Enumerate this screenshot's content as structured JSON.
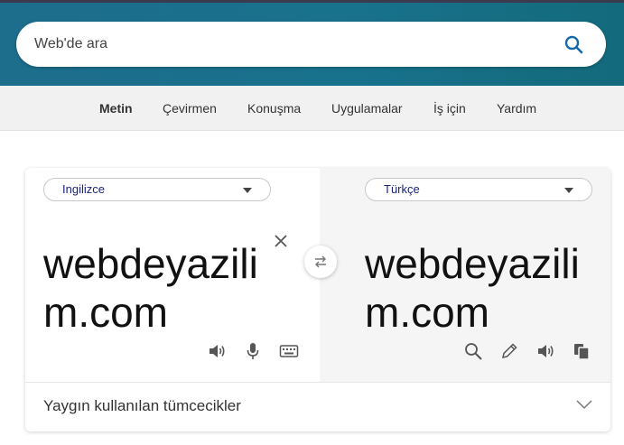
{
  "search": {
    "placeholder": "Web'de ara"
  },
  "nav": {
    "items": [
      {
        "label": "Metin",
        "active": true
      },
      {
        "label": "Çevirmen"
      },
      {
        "label": "Konuşma"
      },
      {
        "label": "Uygulamalar"
      },
      {
        "label": "İş için"
      },
      {
        "label": "Yardım"
      }
    ]
  },
  "translator": {
    "source_lang": "Ingilizce",
    "target_lang": "Türkçe",
    "source_text": "webdeyazilim.com",
    "target_text": "webdeyazilim.com"
  },
  "phrases": {
    "label": "Yaygın kullanılan tümcecikler"
  },
  "colors": {
    "header": "#18728c",
    "accent": "#1a237e"
  },
  "icons": {
    "search": "search-icon",
    "clear": "close-icon",
    "swap": "swap-icon",
    "source_speaker": "speaker-icon",
    "mic": "microphone-icon",
    "keyboard": "keyboard-icon",
    "lookup": "search-icon",
    "edit": "pencil-icon",
    "target_speaker": "speaker-icon",
    "copy": "copy-icon",
    "expand": "chevron-down-icon"
  }
}
